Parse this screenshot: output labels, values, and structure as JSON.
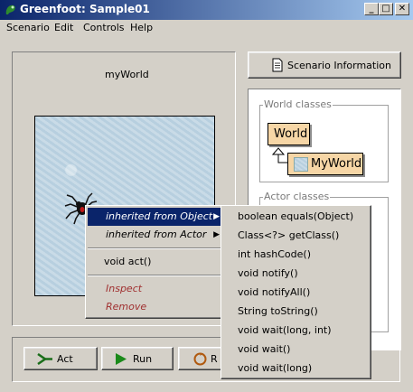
{
  "window": {
    "title": "Greenfoot: Sample01",
    "minimize_glyph": "_",
    "maximize_glyph": "□",
    "close_glyph": "✕"
  },
  "menubar": {
    "items": [
      "Scenario",
      "Edit",
      "Controls",
      "Help"
    ]
  },
  "world": {
    "title": "myWorld",
    "actor_icon": "spider-icon"
  },
  "controls": {
    "act_label": "Act",
    "run_label": "Run",
    "reset_label": "R"
  },
  "scenario_info_label": "Scenario Information",
  "class_browser": {
    "world_group_label": "World classes",
    "world_class": "World",
    "my_world_class": "MyWorld",
    "actor_group_label": "Actor classes"
  },
  "context_menu": {
    "items": [
      {
        "label": "inherited from Object",
        "submenu": true,
        "highlighted": true
      },
      {
        "label": "inherited from Actor",
        "submenu": true
      },
      {
        "label": "void act()"
      },
      {
        "label": "Inspect",
        "disabled_style": true
      },
      {
        "label": "Remove",
        "disabled_style": true
      }
    ]
  },
  "submenu": {
    "items": [
      "boolean equals(Object)",
      "Class<?> getClass()",
      "int hashCode()",
      "void notify()",
      "void notifyAll()",
      "String toString()",
      "void wait(long, int)",
      "void wait()",
      "void wait(long)"
    ]
  },
  "colors": {
    "titlebar_start": "#0a246a",
    "titlebar_end": "#a6caf0",
    "class_box": "#f6d6a6",
    "menu_highlight": "#0a246a",
    "act_arrow": "#1a6e1a",
    "run_arrow": "#1a8a1a"
  }
}
